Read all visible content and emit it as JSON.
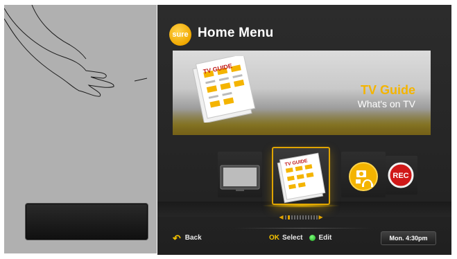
{
  "screen": {
    "brand_logo_text": "sure",
    "title": "Home Menu"
  },
  "hero": {
    "book_label": "TV GUIDE",
    "title": "TV Guide",
    "subtitle": "What's on TV"
  },
  "carousel": {
    "items": [
      {
        "name": "tv",
        "icon": "tv-screen-icon"
      },
      {
        "name": "tv-guide",
        "icon": "tv-guide-book-icon",
        "label": "TV GUIDE",
        "selected": true
      },
      {
        "name": "media",
        "icon": "media-photo-music-icon"
      },
      {
        "name": "recordings",
        "icon": "rec-icon",
        "label": "REC"
      }
    ],
    "page_dots": 12,
    "active_dot": 2
  },
  "footer": {
    "back_label": "Back",
    "ok_key": "OK",
    "select_label": "Select",
    "edit_label": "Edit",
    "clock": "Mon. 4:30pm"
  },
  "colors": {
    "accent": "#f4b400",
    "screen_bg": "#2a2a2a",
    "sketch_panel": "#b0b0b0",
    "edit_button": "#1ea31e"
  }
}
